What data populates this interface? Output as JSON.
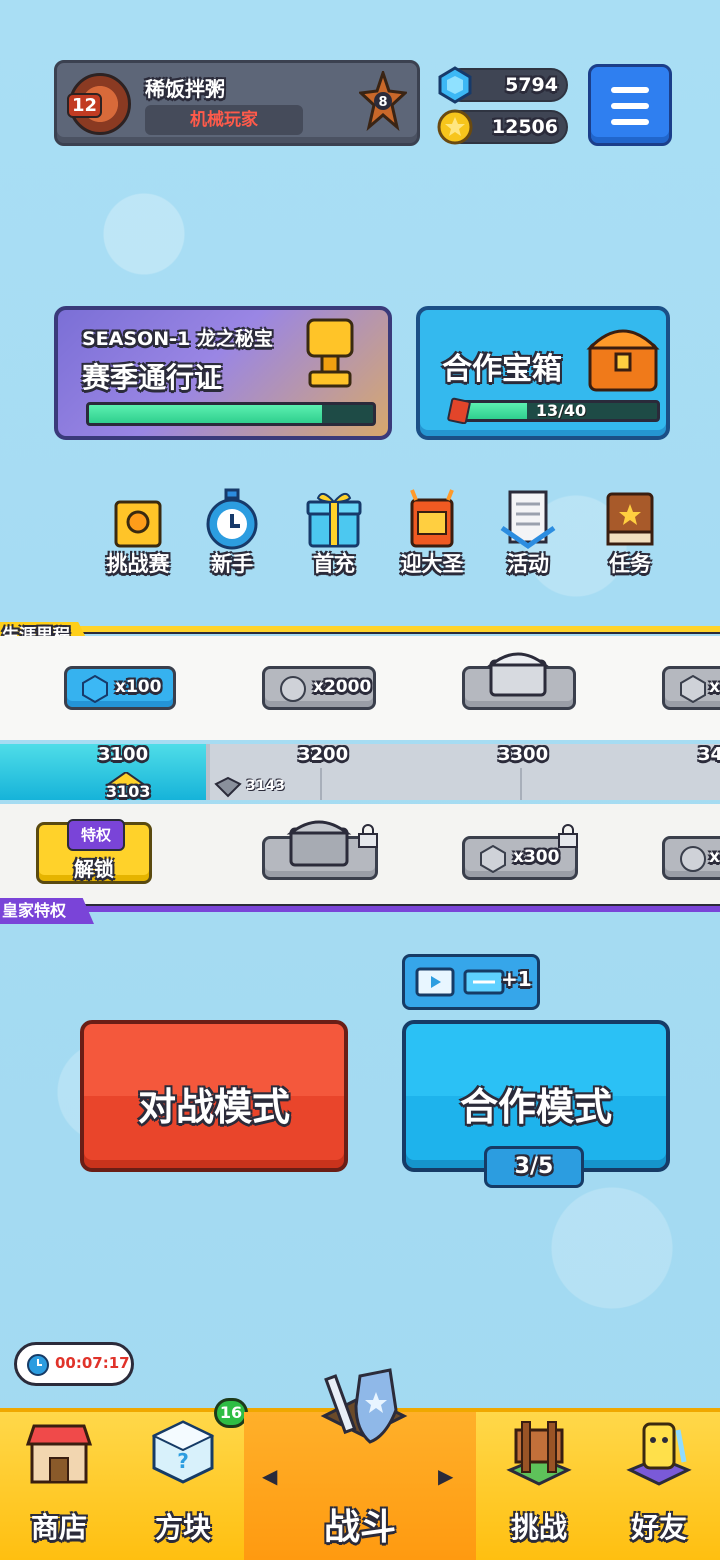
{
  "profile": {
    "level": "12",
    "name": "稀饭拌粥",
    "title": "机械玩家",
    "rank_number": "8"
  },
  "currency": {
    "gems": "5794",
    "coins": "12506"
  },
  "season": {
    "title": "SEASON-1 龙之秘宝",
    "subtitle": "赛季通行证",
    "progress": 0.82
  },
  "coop_chest": {
    "title": "合作宝箱",
    "count": "13/40",
    "progress": 0.325
  },
  "quick_icons": [
    {
      "label": "挑战赛",
      "icon": "trophy-block-icon"
    },
    {
      "label": "新手",
      "icon": "stopwatch-icon"
    },
    {
      "label": "首充",
      "icon": "gift-box-icon"
    },
    {
      "label": "迎大圣",
      "icon": "monkey-king-icon"
    },
    {
      "label": "活动",
      "icon": "newspaper-icon"
    },
    {
      "label": "任务",
      "icon": "quest-book-icon"
    }
  ],
  "career": {
    "label": "生涯里程",
    "free_rewards": [
      "x100",
      "x2000",
      "",
      "x"
    ],
    "ticks": [
      "3100",
      "3200",
      "3300",
      "34"
    ],
    "current": "3103",
    "next_marker": "3143",
    "vip_label": "皇家特权",
    "unlock_badge": "特权",
    "unlock_label": "解锁",
    "vip_rewards": [
      "",
      "x300",
      "x"
    ]
  },
  "modes": {
    "battle": "对战模式",
    "coop": "合作模式",
    "coop_quota": "3/5",
    "ticket_plus": "+1"
  },
  "timer": "00:07:17",
  "nav": {
    "shop": "商店",
    "blocks": "方块",
    "blocks_badge": "16",
    "battle": "战斗",
    "challenge": "挑战",
    "friends": "好友"
  },
  "colors": {
    "accent_blue": "#2f7ff0",
    "battle_red": "#f4583c",
    "coop_cyan": "#2bc1f5",
    "nav_yellow": "#ffc928"
  }
}
